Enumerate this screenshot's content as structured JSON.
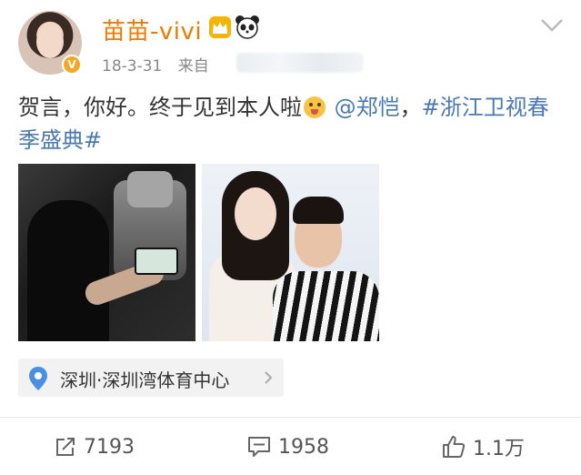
{
  "post": {
    "username": "苗苗-vivi",
    "verified_mark": "V",
    "date": "18-3-31",
    "source_prefix": "来自",
    "text_plain": "贺言，你好。终于见到本人啦",
    "mention": "@郑恺",
    "separator": "，",
    "hashtag": "#浙江卫视春季盛典#"
  },
  "location": {
    "label": "深圳·深圳湾体育中心"
  },
  "actions": {
    "repost_count": "7193",
    "comment_count": "1958",
    "like_count": "1.1万"
  },
  "colors": {
    "username": "#f07a00",
    "link": "#4a79b2",
    "meta": "#888888"
  },
  "icons": [
    "crown-badge-icon",
    "panda-icon",
    "chevron-down-icon",
    "emoji-icon",
    "location-pin-icon",
    "chevron-right-icon",
    "repost-icon",
    "comment-icon",
    "like-icon"
  ]
}
